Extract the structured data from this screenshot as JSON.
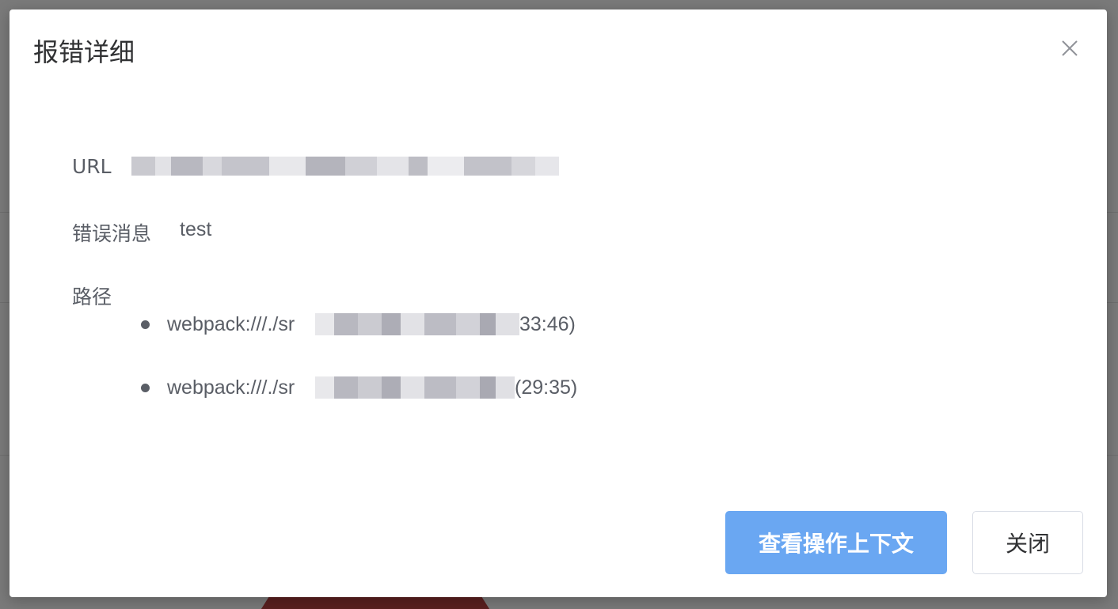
{
  "dialog": {
    "title": "报错详细",
    "close_icon": "close-icon"
  },
  "fields": {
    "url_label": "URL",
    "message_label": "错误消息",
    "message_value": "test",
    "path_label": "路径"
  },
  "stack": [
    {
      "prefix": "webpack:///./sr",
      "suffix": "33:46)"
    },
    {
      "prefix": "webpack:///./sr",
      "suffix": "(29:35)"
    }
  ],
  "buttons": {
    "view_context": "查看操作上下文",
    "close": "关闭"
  },
  "colors": {
    "primary": "#6aa7f2",
    "text": "#5a5e66",
    "title": "#303133",
    "overlay": "#7a7a7a"
  }
}
